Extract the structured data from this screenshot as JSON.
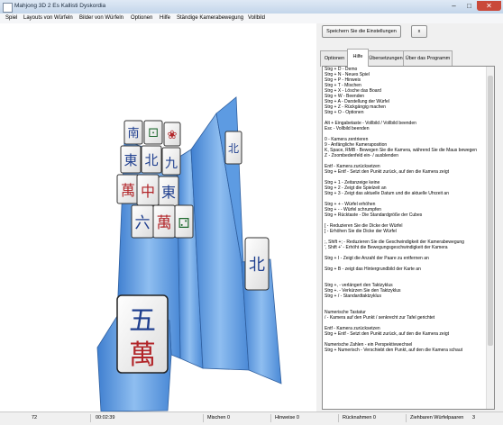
{
  "window": {
    "title": "Mahjong 3D 2 Es Kallisti Dyskordia",
    "minimize_glyph": "–",
    "maximize_glyph": "□",
    "close_glyph": "✕"
  },
  "menu": [
    "Spiel",
    "Layouts von Würfeln",
    "Bilder von Würfeln",
    "Optionen",
    "Hilfe",
    "Ständige Kamerabewegung",
    "Vollbild"
  ],
  "buttons": {
    "save_settings": "Speichern Sie die Einstellungen",
    "close_x": "x"
  },
  "tabs": [
    "Optionen",
    "Hilfe",
    "Übersetzungen",
    "Über das Programm"
  ],
  "active_tab": "Hilfe",
  "help_lines": [
    "Strg + D - Demo",
    "Strg + N - Neues Spiel",
    "Strg + P - Hinweis",
    "Strg + T - Mischen",
    "Strg + X - Lösche das Board",
    "Strg + W - Beenden",
    "Strg + A - Darstellung der Würfel",
    "Strg + Z - Rückgängig machen",
    "Strg + O - Optionen",
    "",
    "Alt + Eingabetaste - Vollbild / Vollbild beenden",
    "Esc - Vollbild beenden",
    "",
    "0 - Kamera zentrieren",
    "9 - Anfängliche Kameraposition",
    "K, Space, RMB - Bewegen Sie die Kamera, während Sie die Maus bewegen",
    "Z - Zoombedenfeld ein- / ausblenden",
    "",
    "Entf - Kamera zurücksetzen",
    "Strg + Entf - Setzt den Punkt zurück, auf den die Kamera zeigt",
    "",
    "Strg + 1 - Zeitanzeige keine",
    "Strg + 2 - Zeigt die Spielzeit an",
    "Strg + 3 - Zeigt das aktuelle Datum und die aktuelle Uhrzeit an",
    "",
    "Strg + + - Würfel erhöhen",
    "Strg + - - Würfel schrumpfen",
    "Strg + Rücktaste - Die Standardgröße der Cubes",
    "",
    "[ - Reduzieren Sie die Dicke der Würfel",
    "] - Erhöhen Sie die Dicke der Würfel",
    "",
    ";, Shift +; - Reduzieren Sie die Geschwindigkeit der Kamerabewegung",
    "', Shift +' - Erhöht die Bewegungsgeschwindigkeit der Kamera",
    "",
    "Strg + I - Zeigt die Anzahl der Paare zu entfernen an",
    "",
    "Strg + B - zeigt das Hintergrundbild der Karte an",
    "",
    "",
    "Strg +, - verlängert den Taktzyklus",
    "Strg +. - Verkürzen Sie den Taktzyklus",
    "Strg + / - Standardtaktzyklus",
    "",
    "",
    "Numerische Tastatur",
    "/ - Kamera auf den Punkt / senkrecht zur Tafel gerichtet",
    "",
    "Entf - Kamera zurücksetzen",
    "Strg + Entf - Setzt den Punkt zurück, auf den die Kamera zeigt",
    "",
    "Numerische Zahlen - ein Perspektivwechsel",
    "Strg + Numerisch - Verschiebt den Punkt, auf den die Kamera schaut"
  ],
  "status": {
    "tiles_left": "72",
    "time": "00:02:39",
    "shuffles": "Mischen 0",
    "hints": "Hinweise 0",
    "undos": "Rücknahmen 0",
    "pairs_label": "Ziehbaren Würfelpaaren",
    "pairs_value": "3"
  },
  "tiles": [
    {
      "char": "南",
      "color": "#1f3f8f"
    },
    {
      "char": "⚀",
      "color": "#1f6a2f"
    },
    {
      "char": "❀",
      "color": "#b2262a"
    },
    {
      "char": "東",
      "color": "#1f3f8f"
    },
    {
      "char": "北",
      "color": "#1f3f8f"
    },
    {
      "char": "九",
      "color": "#1f3f8f"
    },
    {
      "char": "萬",
      "color": "#b2262a"
    },
    {
      "char": "中",
      "color": "#b2262a"
    },
    {
      "char": "東",
      "color": "#1f3f8f"
    },
    {
      "char": "六",
      "color": "#1f3f8f"
    },
    {
      "char": "萬",
      "color": "#b2262a"
    },
    {
      "char": "五",
      "color": "#1f3f8f"
    },
    {
      "char": "萬",
      "color": "#b2262a"
    },
    {
      "char": "北",
      "color": "#1f3f8f"
    },
    {
      "char": "⚁",
      "color": "#1f6a2f"
    }
  ]
}
